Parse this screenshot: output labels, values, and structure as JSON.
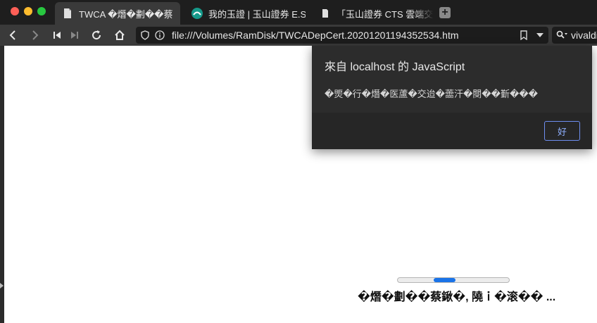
{
  "window": {
    "traffic_lights": {
      "close_color": "#fe5f57",
      "minimize_color": "#febc2e",
      "zoom_color": "#28c840"
    }
  },
  "tabs": [
    {
      "label": "TWCA �熸�劃��蔡",
      "icon": "document-icon",
      "active": true
    },
    {
      "label": "我的玉證 | 玉山證券 E.SUN",
      "icon": "esun-logo-icon",
      "active": false
    },
    {
      "label": "「玉山證券 CTS 雲端交易系",
      "icon": "document-icon",
      "active": false
    }
  ],
  "toolbar": {
    "url": "file:///Volumes/RamDisk/TWCADepCert.20201201194352534.htm",
    "search_text": "vivaldi"
  },
  "dialog": {
    "title": "來自 localhost 的 JavaScript",
    "message": "�煚�行�熸�医蘆�交迨�蘦汗�閿��斳���",
    "ok_label": "好",
    "accent_color": "#6e8ef0"
  },
  "page": {
    "status_text": "�熸�劃��蔡鍬�, 隢ｉ�滚�� ...",
    "progress_fraction": 0.2,
    "progress_offset_fraction": 0.32,
    "progress_color": "#1a73e8"
  }
}
